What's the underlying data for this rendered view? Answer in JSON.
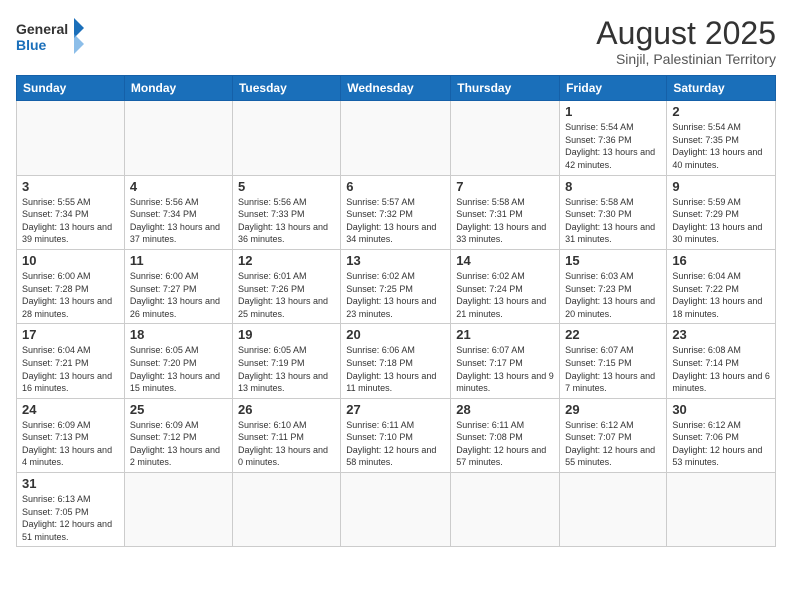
{
  "header": {
    "logo_general": "General",
    "logo_blue": "Blue",
    "main_title": "August 2025",
    "subtitle": "Sinjil, Palestinian Territory"
  },
  "weekdays": [
    "Sunday",
    "Monday",
    "Tuesday",
    "Wednesday",
    "Thursday",
    "Friday",
    "Saturday"
  ],
  "days": {
    "d1": {
      "num": "1",
      "sunrise": "5:54 AM",
      "sunset": "7:36 PM",
      "daylight": "13 hours and 42 minutes."
    },
    "d2": {
      "num": "2",
      "sunrise": "5:54 AM",
      "sunset": "7:35 PM",
      "daylight": "13 hours and 40 minutes."
    },
    "d3": {
      "num": "3",
      "sunrise": "5:55 AM",
      "sunset": "7:34 PM",
      "daylight": "13 hours and 39 minutes."
    },
    "d4": {
      "num": "4",
      "sunrise": "5:56 AM",
      "sunset": "7:34 PM",
      "daylight": "13 hours and 37 minutes."
    },
    "d5": {
      "num": "5",
      "sunrise": "5:56 AM",
      "sunset": "7:33 PM",
      "daylight": "13 hours and 36 minutes."
    },
    "d6": {
      "num": "6",
      "sunrise": "5:57 AM",
      "sunset": "7:32 PM",
      "daylight": "13 hours and 34 minutes."
    },
    "d7": {
      "num": "7",
      "sunrise": "5:58 AM",
      "sunset": "7:31 PM",
      "daylight": "13 hours and 33 minutes."
    },
    "d8": {
      "num": "8",
      "sunrise": "5:58 AM",
      "sunset": "7:30 PM",
      "daylight": "13 hours and 31 minutes."
    },
    "d9": {
      "num": "9",
      "sunrise": "5:59 AM",
      "sunset": "7:29 PM",
      "daylight": "13 hours and 30 minutes."
    },
    "d10": {
      "num": "10",
      "sunrise": "6:00 AM",
      "sunset": "7:28 PM",
      "daylight": "13 hours and 28 minutes."
    },
    "d11": {
      "num": "11",
      "sunrise": "6:00 AM",
      "sunset": "7:27 PM",
      "daylight": "13 hours and 26 minutes."
    },
    "d12": {
      "num": "12",
      "sunrise": "6:01 AM",
      "sunset": "7:26 PM",
      "daylight": "13 hours and 25 minutes."
    },
    "d13": {
      "num": "13",
      "sunrise": "6:02 AM",
      "sunset": "7:25 PM",
      "daylight": "13 hours and 23 minutes."
    },
    "d14": {
      "num": "14",
      "sunrise": "6:02 AM",
      "sunset": "7:24 PM",
      "daylight": "13 hours and 21 minutes."
    },
    "d15": {
      "num": "15",
      "sunrise": "6:03 AM",
      "sunset": "7:23 PM",
      "daylight": "13 hours and 20 minutes."
    },
    "d16": {
      "num": "16",
      "sunrise": "6:04 AM",
      "sunset": "7:22 PM",
      "daylight": "13 hours and 18 minutes."
    },
    "d17": {
      "num": "17",
      "sunrise": "6:04 AM",
      "sunset": "7:21 PM",
      "daylight": "13 hours and 16 minutes."
    },
    "d18": {
      "num": "18",
      "sunrise": "6:05 AM",
      "sunset": "7:20 PM",
      "daylight": "13 hours and 15 minutes."
    },
    "d19": {
      "num": "19",
      "sunrise": "6:05 AM",
      "sunset": "7:19 PM",
      "daylight": "13 hours and 13 minutes."
    },
    "d20": {
      "num": "20",
      "sunrise": "6:06 AM",
      "sunset": "7:18 PM",
      "daylight": "13 hours and 11 minutes."
    },
    "d21": {
      "num": "21",
      "sunrise": "6:07 AM",
      "sunset": "7:17 PM",
      "daylight": "13 hours and 9 minutes."
    },
    "d22": {
      "num": "22",
      "sunrise": "6:07 AM",
      "sunset": "7:15 PM",
      "daylight": "13 hours and 7 minutes."
    },
    "d23": {
      "num": "23",
      "sunrise": "6:08 AM",
      "sunset": "7:14 PM",
      "daylight": "13 hours and 6 minutes."
    },
    "d24": {
      "num": "24",
      "sunrise": "6:09 AM",
      "sunset": "7:13 PM",
      "daylight": "13 hours and 4 minutes."
    },
    "d25": {
      "num": "25",
      "sunrise": "6:09 AM",
      "sunset": "7:12 PM",
      "daylight": "13 hours and 2 minutes."
    },
    "d26": {
      "num": "26",
      "sunrise": "6:10 AM",
      "sunset": "7:11 PM",
      "daylight": "13 hours and 0 minutes."
    },
    "d27": {
      "num": "27",
      "sunrise": "6:11 AM",
      "sunset": "7:10 PM",
      "daylight": "12 hours and 58 minutes."
    },
    "d28": {
      "num": "28",
      "sunrise": "6:11 AM",
      "sunset": "7:08 PM",
      "daylight": "12 hours and 57 minutes."
    },
    "d29": {
      "num": "29",
      "sunrise": "6:12 AM",
      "sunset": "7:07 PM",
      "daylight": "12 hours and 55 minutes."
    },
    "d30": {
      "num": "30",
      "sunrise": "6:12 AM",
      "sunset": "7:06 PM",
      "daylight": "12 hours and 53 minutes."
    },
    "d31": {
      "num": "31",
      "sunrise": "6:13 AM",
      "sunset": "7:05 PM",
      "daylight": "12 hours and 51 minutes."
    }
  }
}
